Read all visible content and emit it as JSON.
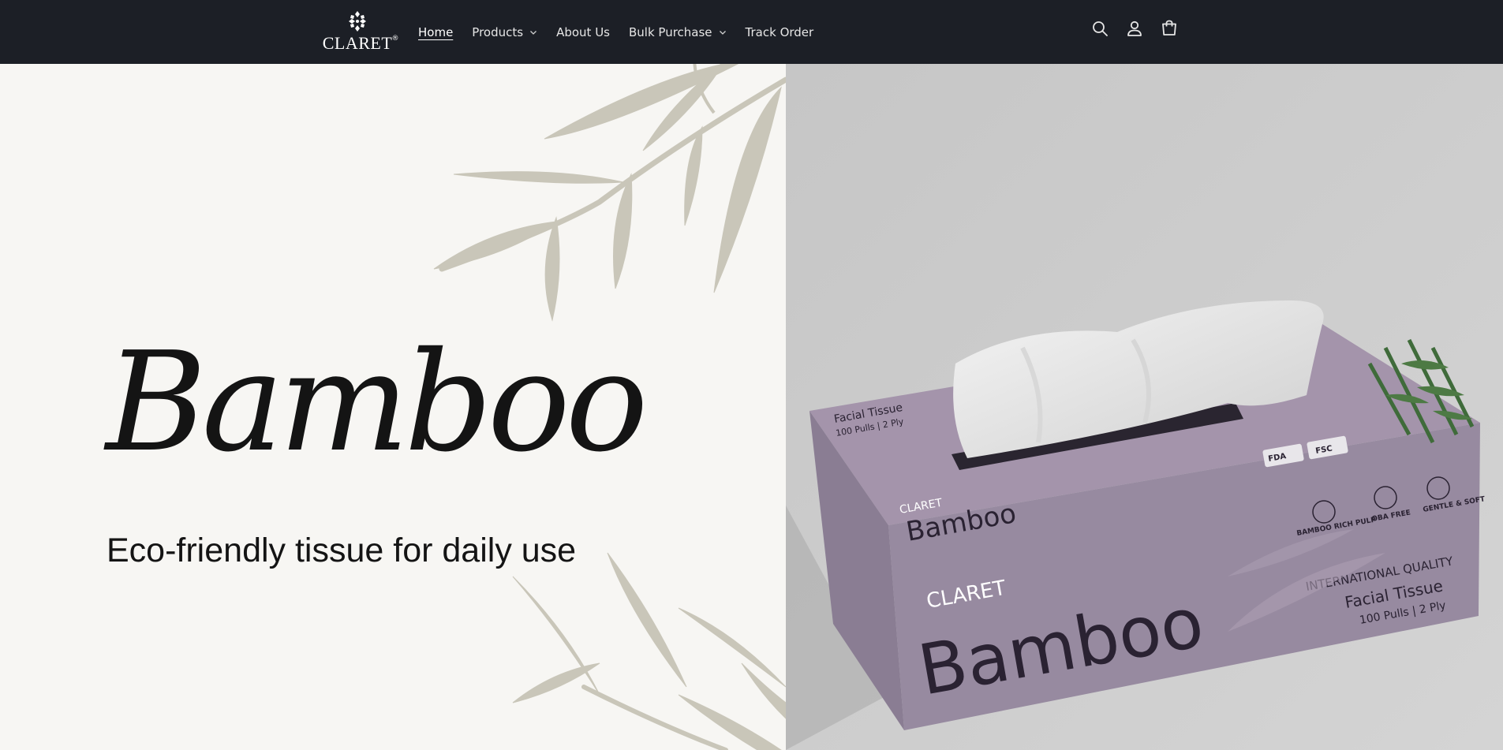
{
  "brand": {
    "name": "CLARET",
    "registered_mark": "®",
    "logo_icon": "claret-logo-mark"
  },
  "nav": {
    "items": [
      {
        "label": "Home",
        "active": true,
        "has_dropdown": false
      },
      {
        "label": "Products",
        "active": false,
        "has_dropdown": true
      },
      {
        "label": "About Us",
        "active": false,
        "has_dropdown": false
      },
      {
        "label": "Bulk Purchase",
        "active": false,
        "has_dropdown": true
      },
      {
        "label": "Track Order",
        "active": false,
        "has_dropdown": false
      }
    ]
  },
  "header_icons": [
    "search-icon",
    "account-icon",
    "cart-icon"
  ],
  "hero": {
    "title": "Bamboo",
    "subtitle": "Eco-friendly tissue for daily use"
  },
  "product_box": {
    "top_label": "Facial Tissue",
    "top_sub": "100 Pulls | 2 Ply",
    "brand": "CLARET",
    "name": "Bamboo",
    "quality": "INTERNATIONAL QUALITY",
    "type": "Facial Tissue",
    "count": "100 Pulls | 2 Ply",
    "badges": [
      "BAMBOO RICH PULP",
      "OBA FREE",
      "GENTLE & SOFT"
    ],
    "cert_labels": [
      "FDA",
      "FSC"
    ]
  },
  "colors": {
    "header_bg": "#1c1f26",
    "hero_left_bg": "#f7f6f3",
    "hero_right_bg": "#c8c8c8",
    "leaf": "#c9c6b9",
    "box_purple": "#9a8aa0",
    "box_dark_text": "#2a2232"
  }
}
